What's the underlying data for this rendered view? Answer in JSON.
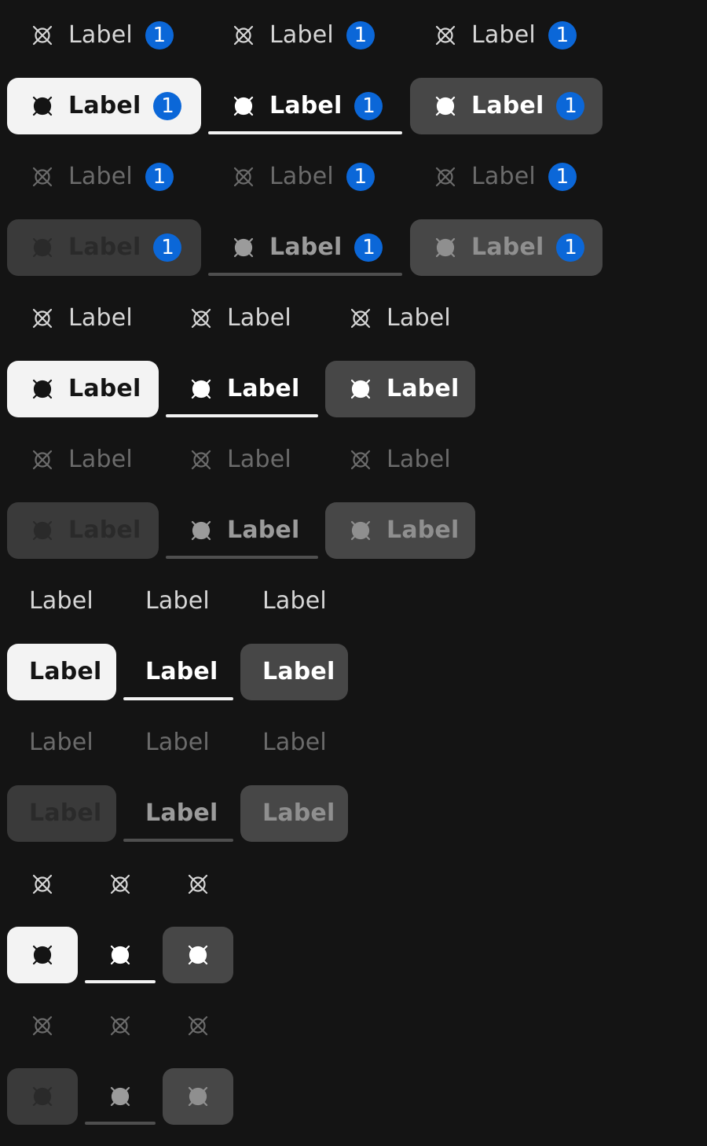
{
  "tab_label": "Label",
  "badge_count": "1",
  "icons": {
    "outline": "icon-outline",
    "filled": "icon-filled"
  },
  "colors": {
    "background": "#141414",
    "selected_fill": "#f3f3f3",
    "selected_gray": "#474747",
    "badge": "#0b67d8",
    "text_default": "#d6d6d6",
    "text_disabled": "#6b6b6b"
  }
}
